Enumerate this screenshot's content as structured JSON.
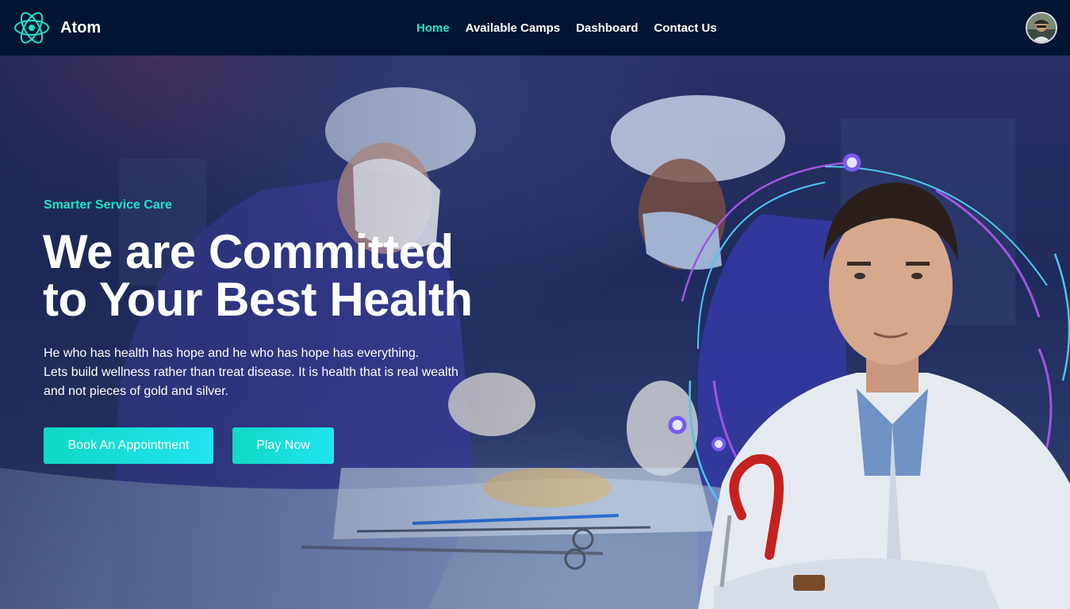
{
  "brand": {
    "name": "Atom",
    "logo_icon": "atom-icon",
    "accent": "#1de3c6"
  },
  "nav": {
    "items": [
      {
        "label": "Home",
        "active": true
      },
      {
        "label": "Available Camps",
        "active": false
      },
      {
        "label": "Dashboard",
        "active": false
      },
      {
        "label": "Contact Us",
        "active": false
      }
    ],
    "avatar_icon": "user-avatar"
  },
  "hero": {
    "tagline": "Smarter Service Care",
    "headline_line1": "We are Committed",
    "headline_line2": "to Your Best Health",
    "description_line1": "He who has health has hope and he who has hope has everything.",
    "description_line2": "Lets build wellness rather than treat disease. It is health that is real wealth",
    "description_line3": "and not pieces of gold and silver.",
    "buttons": {
      "book": "Book An Appointment",
      "play": "Play Now"
    }
  },
  "colors": {
    "navbar_bg": "#021533",
    "accent": "#1de3c6",
    "button_gradient_end": "#22e3f2"
  }
}
